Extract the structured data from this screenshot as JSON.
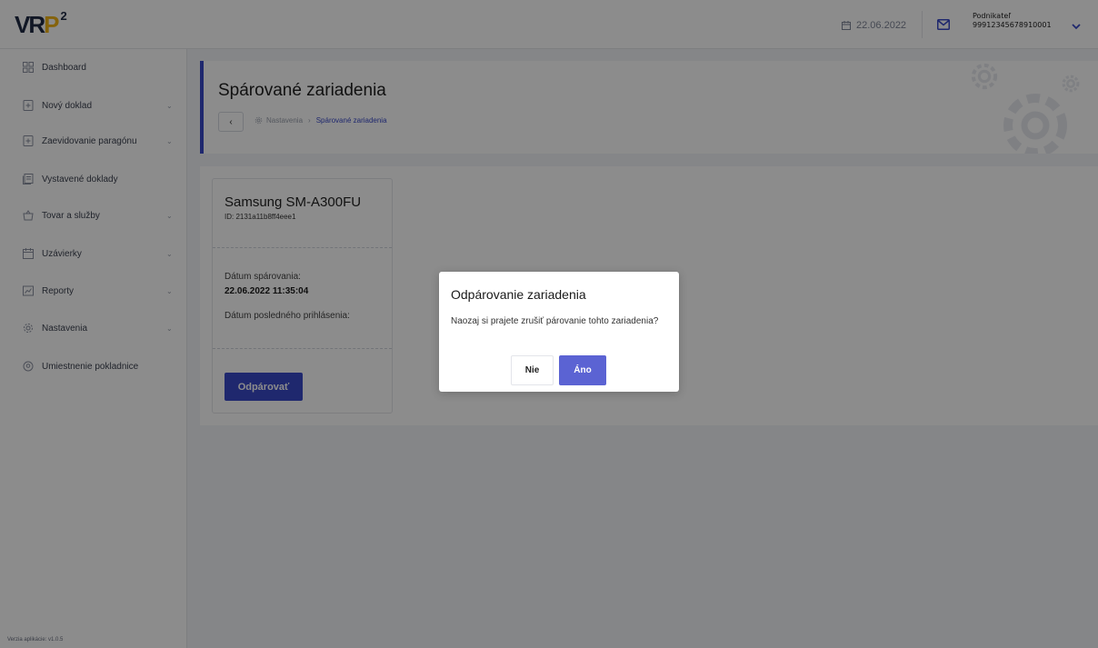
{
  "app": {
    "logo_main": "VR",
    "logo_accent": "P",
    "logo_superscript": "2"
  },
  "topbar": {
    "date": "22.06.2022",
    "user_role": "Podnikateľ",
    "user_id": "99912345678910001"
  },
  "sidebar": {
    "items": [
      {
        "label": "Dashboard",
        "icon": "dashboard-icon",
        "has_chevron": false
      },
      {
        "label": "Nový doklad",
        "icon": "document-plus-icon",
        "has_chevron": true
      },
      {
        "label": "Zaevidovanie paragónu",
        "icon": "document-plus-icon",
        "has_chevron": true
      },
      {
        "label": "Vystavené doklady",
        "icon": "documents-icon",
        "has_chevron": false
      },
      {
        "label": "Tovar a služby",
        "icon": "basket-icon",
        "has_chevron": true
      },
      {
        "label": "Uzávierky",
        "icon": "calendar-icon",
        "has_chevron": true
      },
      {
        "label": "Reporty",
        "icon": "report-icon",
        "has_chevron": true
      },
      {
        "label": "Nastavenia",
        "icon": "gear-icon",
        "has_chevron": true
      },
      {
        "label": "Umiestnenie pokladnice",
        "icon": "location-pin-icon",
        "has_chevron": false
      }
    ],
    "version": "Verzia aplikácie: v1.0.5"
  },
  "page": {
    "title": "Spárované zariadenia",
    "breadcrumb_parent": "Nastavenia",
    "breadcrumb_separator": "›",
    "breadcrumb_current": "Spárované zariadenia",
    "back_label": "‹"
  },
  "device": {
    "name": "Samsung SM-A300FU",
    "id_text": "ID: 2131a11b8ff4eee1",
    "paired_label": "Dátum spárovania:",
    "paired_value": "22.06.2022 11:35:04",
    "last_login_label": "Dátum posledného prihlásenia:",
    "unpair_label": "Odpárovať"
  },
  "modal": {
    "title": "Odpárovanie zariadenia",
    "message": "Naozaj si prajete zrušiť párovanie tohto zariadenia?",
    "no_label": "Nie",
    "yes_label": "Áno"
  },
  "colors": {
    "accent": "#3949c8",
    "confirm": "#5b63d3",
    "logo_yellow": "#f2b416",
    "logo_dark": "#1f2a44"
  }
}
